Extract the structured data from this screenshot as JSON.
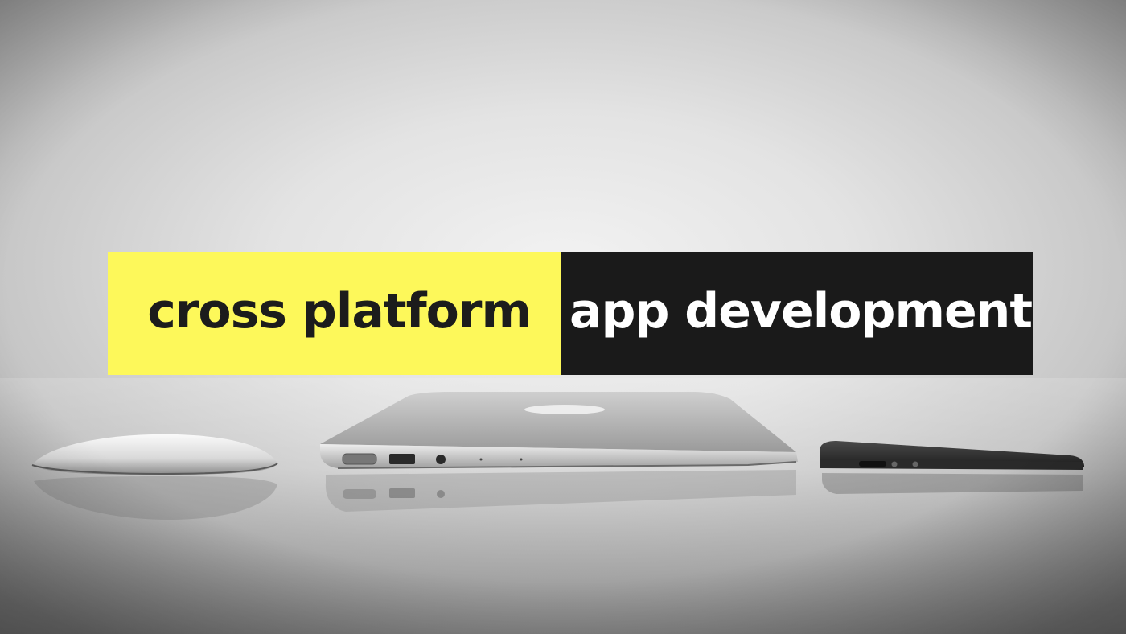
{
  "banner": {
    "left_text": "cross platform",
    "right_text": "app development",
    "left_bg": "#fdf85a",
    "right_bg": "#1a1a1a",
    "left_color": "#1c1c1c",
    "right_color": "#ffffff"
  },
  "photo": {
    "style": "grayscale",
    "objects": [
      "mouse",
      "laptop",
      "phone"
    ]
  }
}
